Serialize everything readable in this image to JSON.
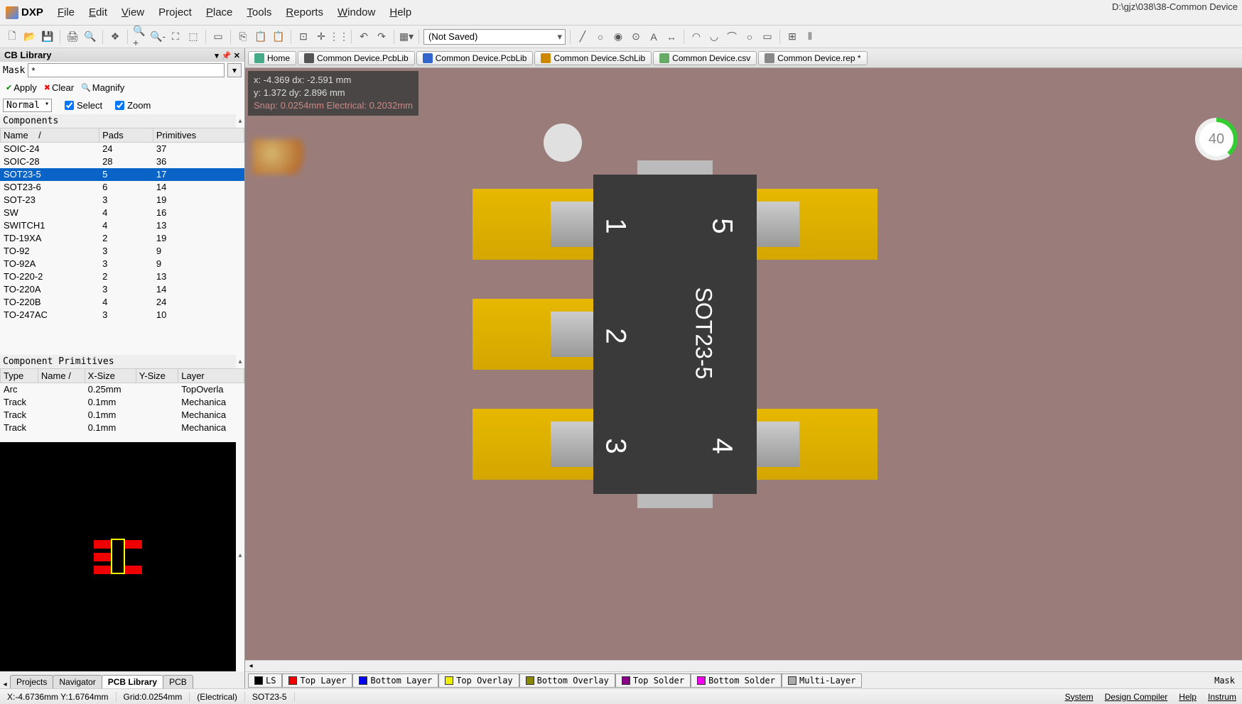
{
  "title_path": "D:\\gjz\\038\\38-Common Device",
  "menu": [
    "File",
    "Edit",
    "View",
    "Project",
    "Place",
    "Tools",
    "Reports",
    "Window",
    "Help"
  ],
  "dxp_label": "DXP",
  "combo_saved": "(Not Saved)",
  "panel": {
    "title": "CB Library",
    "mask_label": "Mask",
    "mask_value": "*",
    "apply": "Apply",
    "clear": "Clear",
    "magnify": "Magnify",
    "normal": "Normal",
    "select": "Select",
    "zoom": "Zoom"
  },
  "components": {
    "header": "Components",
    "cols": [
      "Name",
      "Pads",
      "Primitives"
    ],
    "rows": [
      {
        "name": "SOIC-24",
        "pads": "24",
        "prim": "37"
      },
      {
        "name": "SOIC-28",
        "pads": "28",
        "prim": "36"
      },
      {
        "name": "SOT23-5",
        "pads": "5",
        "prim": "17",
        "sel": true
      },
      {
        "name": "SOT23-6",
        "pads": "6",
        "prim": "14"
      },
      {
        "name": "SOT-23",
        "pads": "3",
        "prim": "19"
      },
      {
        "name": "SW",
        "pads": "4",
        "prim": "16"
      },
      {
        "name": "SWITCH1",
        "pads": "4",
        "prim": "13"
      },
      {
        "name": "TD-19XA",
        "pads": "2",
        "prim": "19"
      },
      {
        "name": "TO-92",
        "pads": "3",
        "prim": "9"
      },
      {
        "name": "TO-92A",
        "pads": "3",
        "prim": "9"
      },
      {
        "name": "TO-220-2",
        "pads": "2",
        "prim": "13"
      },
      {
        "name": "TO-220A",
        "pads": "3",
        "prim": "14"
      },
      {
        "name": "TO-220B",
        "pads": "4",
        "prim": "24"
      },
      {
        "name": "TO-247AC",
        "pads": "3",
        "prim": "10"
      }
    ]
  },
  "primitives": {
    "header": "Component Primitives",
    "cols": [
      "Type",
      "Name",
      "X-Size",
      "Y-Size",
      "Layer"
    ],
    "rows": [
      {
        "type": "Arc",
        "name": "",
        "x": "0.25mm",
        "y": "",
        "layer": "TopOverla"
      },
      {
        "type": "Track",
        "name": "",
        "x": "0.1mm",
        "y": "",
        "layer": "Mechanica"
      },
      {
        "type": "Track",
        "name": "",
        "x": "0.1mm",
        "y": "",
        "layer": "Mechanica"
      },
      {
        "type": "Track",
        "name": "",
        "x": "0.1mm",
        "y": "",
        "layer": "Mechanica"
      }
    ]
  },
  "left_tabs": [
    "Projects",
    "Navigator",
    "PCB Library",
    "PCB"
  ],
  "left_tab_active": 2,
  "doc_tabs": [
    {
      "label": "Home",
      "color": "#4a8"
    },
    {
      "label": "Common Device.PcbLib",
      "color": "#555"
    },
    {
      "label": "Common Device.PcbLib",
      "color": "#36c"
    },
    {
      "label": "Common Device.SchLib",
      "color": "#c80"
    },
    {
      "label": "Common Device.csv",
      "color": "#6a6"
    },
    {
      "label": "Common Device.rep *",
      "color": "#888"
    }
  ],
  "coords": {
    "l1": "x: -4.369  dx: -2.591 mm",
    "l2": "y:  1.372  dy:  2.896 mm",
    "snap": "Snap: 0.0254mm Electrical: 0.2032mm"
  },
  "comp_label": "SOT23-5",
  "pins": [
    "1",
    "2",
    "3",
    "4",
    "5"
  ],
  "layers": [
    {
      "label": "LS",
      "color": "#000"
    },
    {
      "label": "Top Layer",
      "color": "#e00"
    },
    {
      "label": "Bottom Layer",
      "color": "#00e"
    },
    {
      "label": "Top Overlay",
      "color": "#ee0"
    },
    {
      "label": "Bottom Overlay",
      "color": "#880"
    },
    {
      "label": "Top Solder",
      "color": "#808"
    },
    {
      "label": "Bottom Solder",
      "color": "#e0e"
    },
    {
      "label": "Multi-Layer",
      "color": "#aaa"
    }
  ],
  "mask_tab": "Mask",
  "status": {
    "xy": "X:-4.6736mm Y:1.6764mm",
    "grid": "Grid:0.0254mm",
    "mode": "(Electrical)",
    "comp": "SOT23-5",
    "links": [
      "System",
      "Design Compiler",
      "Help",
      "Instrum"
    ]
  },
  "gauge_text": "40"
}
